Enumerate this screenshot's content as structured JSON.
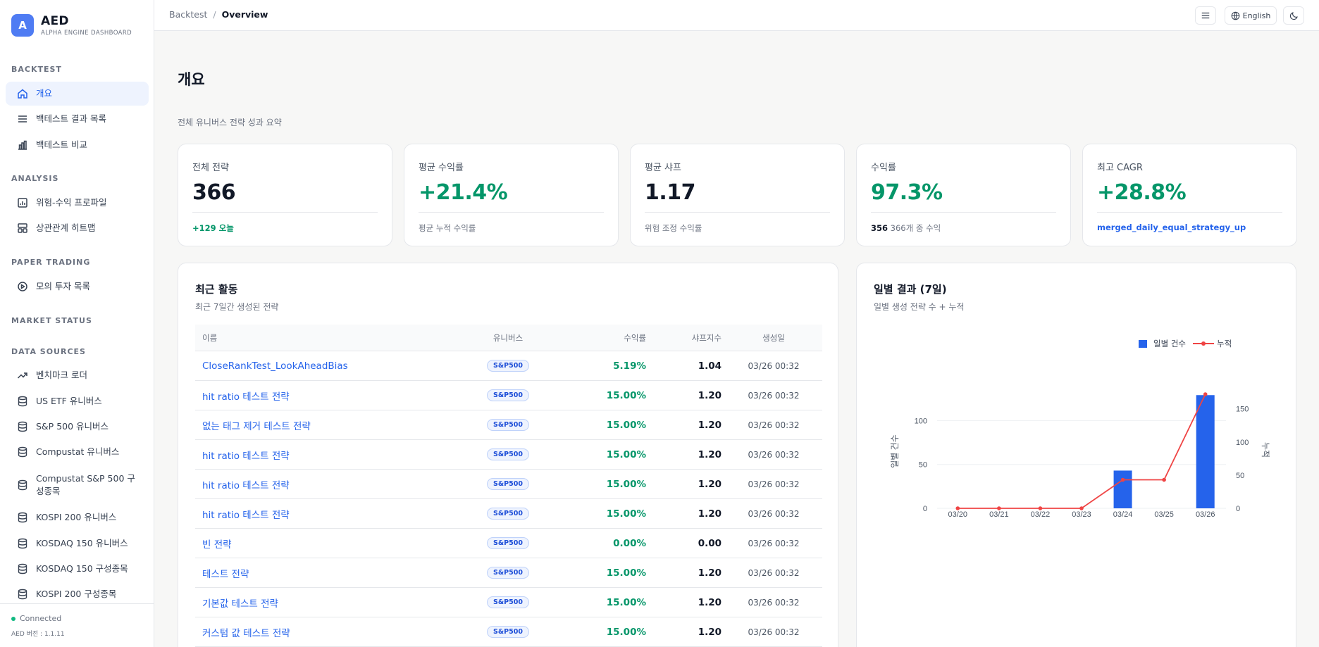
{
  "brand": {
    "logo_letter": "A",
    "title": "AED",
    "subtitle": "ALPHA ENGINE DASHBOARD"
  },
  "sidebar": {
    "sections": [
      {
        "title": "BACKTEST",
        "items": [
          {
            "label": "개요",
            "icon": "home-icon",
            "active": true
          },
          {
            "label": "백테스트 결과 목록",
            "icon": "list-icon"
          },
          {
            "label": "백테스트 비교",
            "icon": "bar-chart-icon"
          }
        ]
      },
      {
        "title": "ANALYSIS",
        "items": [
          {
            "label": "위험-수익 프로파일",
            "icon": "chart-box-icon"
          },
          {
            "label": "상관관계 히트맵",
            "icon": "grid-icon"
          }
        ]
      },
      {
        "title": "PAPER TRADING",
        "items": [
          {
            "label": "모의 투자 목록",
            "icon": "play-circle-icon"
          }
        ]
      },
      {
        "title": "MARKET STATUS",
        "items": []
      },
      {
        "title": "DATA SOURCES",
        "items": [
          {
            "label": "벤치마크 로더",
            "icon": "trending-up-icon"
          },
          {
            "label": "US ETF 유니버스",
            "icon": "database-icon"
          },
          {
            "label": "S&P 500 유니버스",
            "icon": "database-icon"
          },
          {
            "label": "Compustat 유니버스",
            "icon": "database-icon"
          },
          {
            "label": "Compustat S&P 500 구성종목",
            "icon": "database-icon"
          },
          {
            "label": "KOSPI 200 유니버스",
            "icon": "database-icon"
          },
          {
            "label": "KOSDAQ 150 유니버스",
            "icon": "database-icon"
          },
          {
            "label": "KOSDAQ 150 구성종목",
            "icon": "database-icon"
          },
          {
            "label": "KOSPI 200 구성종목",
            "icon": "database-icon"
          }
        ]
      }
    ],
    "footer": {
      "status": "Connected",
      "version": "AED 버전 : 1.1.11"
    }
  },
  "topbar": {
    "breadcrumb": [
      "Backtest",
      "Overview"
    ],
    "language": "English"
  },
  "page": {
    "title": "개요",
    "subtitle": "전체 유니버스 전략 성과 요약"
  },
  "stats": [
    {
      "label": "전체 전략",
      "value": "366",
      "foot": "+129 오늘"
    },
    {
      "label": "평균 수익률",
      "value": "+21.4%",
      "foot": "평균 누적 수익률"
    },
    {
      "label": "평균 샤프",
      "value": "1.17",
      "foot": "위험 조정 수익률"
    },
    {
      "label": "수익률",
      "value": "97.3%",
      "foot_strong": "356",
      "foot": "366개 중 수익"
    },
    {
      "label": "최고 CAGR",
      "value": "+28.8%",
      "foot": "merged_daily_equal_strategy_up"
    }
  ],
  "activity": {
    "title": "최근 활동",
    "subtitle": "최근 7일간 생성된 전략",
    "columns": [
      "이름",
      "유니버스",
      "수익률",
      "샤프지수",
      "생성일"
    ],
    "rows": [
      {
        "name": "CloseRankTest_LookAheadBias",
        "universe": "S&P500",
        "return": "5.19%",
        "sharpe": "1.04",
        "date": "03/26 00:32"
      },
      {
        "name": "hit ratio 테스트 전략",
        "universe": "S&P500",
        "return": "15.00%",
        "sharpe": "1.20",
        "date": "03/26 00:32"
      },
      {
        "name": "없는 태그 제거 테스트 전략",
        "universe": "S&P500",
        "return": "15.00%",
        "sharpe": "1.20",
        "date": "03/26 00:32"
      },
      {
        "name": "hit ratio 테스트 전략",
        "universe": "S&P500",
        "return": "15.00%",
        "sharpe": "1.20",
        "date": "03/26 00:32"
      },
      {
        "name": "hit ratio 테스트 전략",
        "universe": "S&P500",
        "return": "15.00%",
        "sharpe": "1.20",
        "date": "03/26 00:32"
      },
      {
        "name": "hit ratio 테스트 전략",
        "universe": "S&P500",
        "return": "15.00%",
        "sharpe": "1.20",
        "date": "03/26 00:32"
      },
      {
        "name": "빈 전략",
        "universe": "S&P500",
        "return": "0.00%",
        "sharpe": "0.00",
        "date": "03/26 00:32"
      },
      {
        "name": "테스트 전략",
        "universe": "S&P500",
        "return": "15.00%",
        "sharpe": "1.20",
        "date": "03/26 00:32"
      },
      {
        "name": "기본값 테스트 전략",
        "universe": "S&P500",
        "return": "15.00%",
        "sharpe": "1.20",
        "date": "03/26 00:32"
      },
      {
        "name": "커스텀 값 테스트 전략",
        "universe": "S&P500",
        "return": "15.00%",
        "sharpe": "1.20",
        "date": "03/26 00:32"
      }
    ]
  },
  "daily": {
    "title": "일별 결과 (7일)",
    "subtitle": "일별 생성 전략 수 + 누적"
  },
  "colors": {
    "accent": "#2563eb",
    "positive": "#059669",
    "bar": "#2563eb",
    "line": "#ef4444"
  },
  "chart_data": {
    "type": "bar",
    "categories": [
      "03/20",
      "03/21",
      "03/22",
      "03/23",
      "03/24",
      "03/25",
      "03/26"
    ],
    "series": [
      {
        "name": "일별 건수",
        "type": "bar",
        "axis": "left",
        "values": [
          0,
          0,
          0,
          0,
          43,
          0,
          129
        ]
      },
      {
        "name": "누적",
        "type": "line",
        "axis": "right",
        "values": [
          0,
          0,
          0,
          0,
          43,
          43,
          172
        ]
      }
    ],
    "ylabel": "일별 건수",
    "ylabel_right": "누적",
    "ylim": [
      0,
      130
    ],
    "ylim_right": [
      0,
      172
    ],
    "yticks": [
      0,
      50,
      100
    ],
    "yticks_right": [
      0,
      50,
      100,
      150
    ],
    "legend": "top-right",
    "grid": true
  }
}
